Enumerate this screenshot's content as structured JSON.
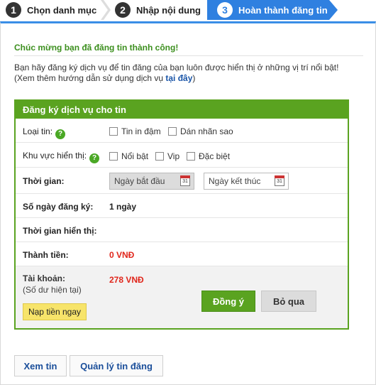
{
  "steps": [
    {
      "num": "1",
      "label": "Chọn danh mục"
    },
    {
      "num": "2",
      "label": "Nhập nội dung"
    },
    {
      "num": "3",
      "label": "Hoàn thành đăng tin"
    }
  ],
  "message": {
    "success": "Chúc mừng bạn đã đăng tin thành công!",
    "intro_line1": "Bạn hãy  đăng ký dịch vụ để tin đăng của bạn luôn được hiển thị ở những vị trí nổi bật!",
    "intro_line2_prefix": "(Xem thêm hướng dẫn sử dụng dịch vụ ",
    "intro_link": "tại đây",
    "intro_line2_suffix": ")"
  },
  "form": {
    "title": "Đăng ký dịch vụ cho tin",
    "help_glyph": "?",
    "loai_tin": {
      "label": "Loại tin:",
      "options": [
        "Tin in đậm",
        "Dán nhãn sao"
      ]
    },
    "khu_vuc": {
      "label": "Khu vực hiển thị:",
      "options": [
        "Nổi bật",
        "Vip",
        "Đặc biệt"
      ]
    },
    "thoi_gian": {
      "label": "Thời gian:",
      "start_placeholder": "Ngày bắt đầu",
      "end_placeholder": "Ngày kết thúc",
      "calendar_num": "31"
    },
    "so_ngay": {
      "label": "Số ngày đăng ký:",
      "value": "1 ngày"
    },
    "thoi_gian_hien_thi": {
      "label": "Thời gian hiển thị:",
      "value": ""
    },
    "thanh_tien": {
      "label": "Thành tiền:",
      "value": "0 VNĐ"
    },
    "tai_khoan": {
      "label": "Tài khoản:",
      "sub": "(Số dư hiện tại)",
      "value": "278 VNĐ"
    },
    "topup_label": "Nạp tiền ngay",
    "agree_label": "Đồng ý",
    "skip_label": "Bỏ qua"
  },
  "bottom": {
    "view_label": "Xem tin",
    "manage_label": "Quản lý tin đăng"
  },
  "colors": {
    "green": "#5aa320",
    "blue": "#2f80e0",
    "red": "#e0261b",
    "yellow": "#f7e46a"
  }
}
